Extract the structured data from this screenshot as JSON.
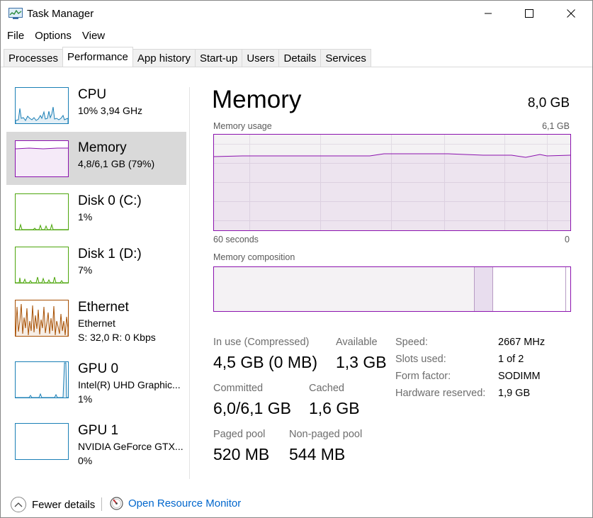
{
  "window": {
    "title": "Task Manager"
  },
  "icons": {
    "app": "task-manager-icon",
    "minimize": "minimize-icon",
    "maximize": "maximize-icon",
    "close": "close-icon",
    "fewer": "chevron-up-icon",
    "resmon": "resource-monitor-icon"
  },
  "menu": [
    "File",
    "Options",
    "View"
  ],
  "tabs": [
    "Processes",
    "Performance",
    "App history",
    "Start-up",
    "Users",
    "Details",
    "Services"
  ],
  "active_tab": "Performance",
  "sidebar": [
    {
      "name": "CPU",
      "sub1": "10%  3,94 GHz",
      "sub2": "",
      "color": "#1a7fb6"
    },
    {
      "name": "Memory",
      "sub1": "4,8/6,1 GB (79%)",
      "sub2": "",
      "color": "#8b12ae",
      "selected": true
    },
    {
      "name": "Disk 0 (C:)",
      "sub1": "1%",
      "sub2": "",
      "color": "#4da60c"
    },
    {
      "name": "Disk 1 (D:)",
      "sub1": "7%",
      "sub2": "",
      "color": "#4da60c"
    },
    {
      "name": "Ethernet",
      "sub1": "Ethernet",
      "sub2": "S: 32,0  R: 0 Kbps",
      "color": "#a74f01"
    },
    {
      "name": "GPU 0",
      "sub1": "Intel(R) UHD Graphic...",
      "sub2": "1%",
      "color": "#1a7fb6"
    },
    {
      "name": "GPU 1",
      "sub1": "NVIDIA GeForce GTX...",
      "sub2": "0%",
      "color": "#1a7fb6"
    }
  ],
  "main": {
    "title": "Memory",
    "total": "8,0 GB",
    "usage_label": "Memory usage",
    "usage_max": "6,1 GB",
    "time_left": "60 seconds",
    "time_right": "0",
    "composition_label": "Memory composition",
    "accent": "#8b12ae",
    "usage_level": 0.79,
    "composition": {
      "in_use": 0.73,
      "modified": 0.05,
      "standby": 0.2,
      "free": 0.02
    }
  },
  "stats": {
    "in_use_label": "In use (Compressed)",
    "in_use_value": "4,5 GB (0 MB)",
    "available_label": "Available",
    "available_value": "1,3 GB",
    "committed_label": "Committed",
    "committed_value": "6,0/6,1 GB",
    "cached_label": "Cached",
    "cached_value": "1,6 GB",
    "paged_label": "Paged pool",
    "paged_value": "520 MB",
    "nonpaged_label": "Non-paged pool",
    "nonpaged_value": "544 MB"
  },
  "specs": [
    {
      "label": "Speed:",
      "value": "2667 MHz"
    },
    {
      "label": "Slots used:",
      "value": "1 of 2"
    },
    {
      "label": "Form factor:",
      "value": "SODIMM"
    },
    {
      "label": "Hardware reserved:",
      "value": "1,9 GB"
    }
  ],
  "bottom": {
    "fewer_details": "Fewer details",
    "open_resmon": "Open Resource Monitor"
  }
}
